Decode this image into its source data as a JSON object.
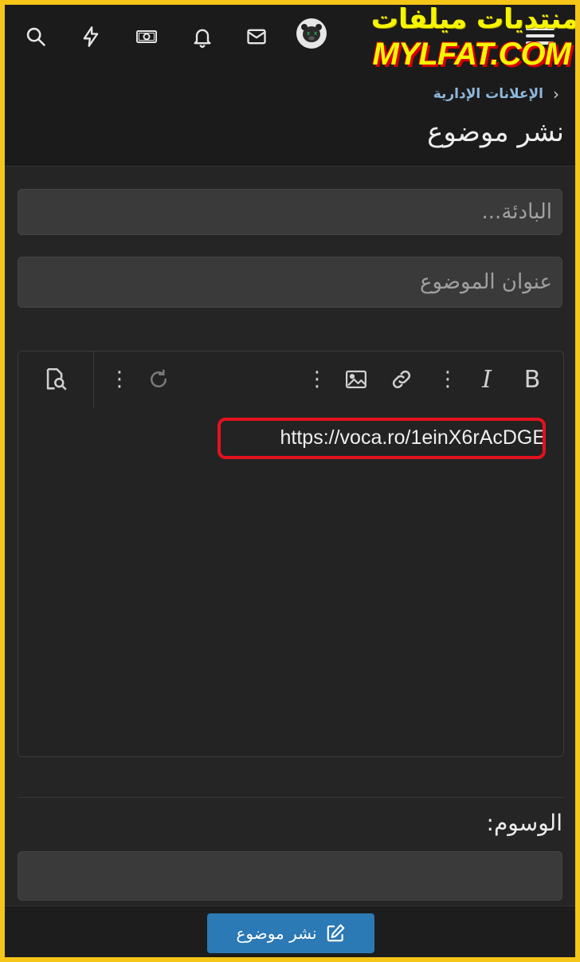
{
  "logo": {
    "arabic_text": "منتديات ميلفات",
    "latin_text": "MYLFAT.COM"
  },
  "navbar": {
    "icons": [
      "search-icon",
      "bolt-icon",
      "money-icon",
      "bell-icon",
      "mail-icon",
      "avatar",
      "menu-icon"
    ]
  },
  "breadcrumb": {
    "label": "الإعلانات الإدارية",
    "chevron": "‹"
  },
  "page": {
    "title": "نشر موضوع"
  },
  "form": {
    "prefix_placeholder": "البادئة...",
    "title_placeholder": "عنوان الموضوع",
    "editor_content": "https://voca.ro/1einX6rAcDGE",
    "tags_label": "الوسوم:",
    "tags_value": ""
  },
  "toolbar": {
    "bold_label": "B",
    "italic_label": "I",
    "more_glyph": "⋮"
  },
  "footer": {
    "submit_label": "نشر موضوع"
  },
  "colors": {
    "frame_border": "#f5c518",
    "background": "#252525",
    "accent_button": "#2b79b5",
    "breadcrumb_link": "#8fb8db",
    "highlight_red": "#e3121e"
  }
}
